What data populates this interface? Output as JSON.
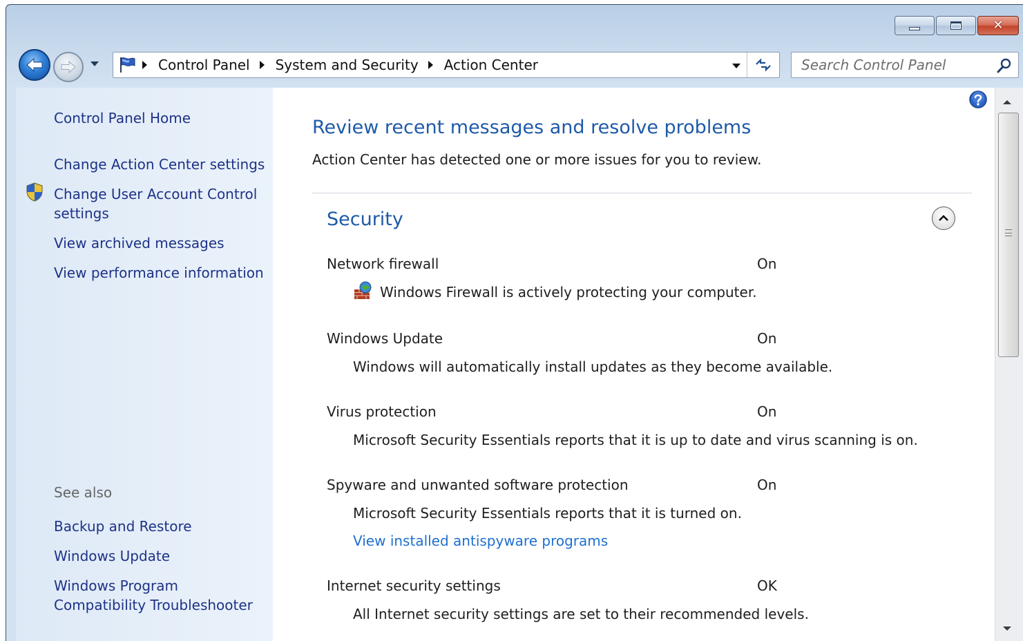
{
  "window": {
    "caption": {
      "minimize_glyph": "",
      "close_glyph": "✕"
    }
  },
  "address": {
    "crumbs": [
      "Control Panel",
      "System and Security",
      "Action Center"
    ]
  },
  "search": {
    "placeholder": "Search Control Panel"
  },
  "sidebar": {
    "items": [
      "Control Panel Home",
      "Change Action Center settings",
      "Change User Account Control settings",
      "View archived messages",
      "View performance information"
    ],
    "see_also_label": "See also",
    "see_also": [
      "Backup and Restore",
      "Windows Update",
      "Windows Program Compatibility Troubleshooter"
    ]
  },
  "main": {
    "title": "Review recent messages and resolve problems",
    "subtitle": "Action Center has detected one or more issues for you to review.",
    "section_title": "Security",
    "items": [
      {
        "label": "Network firewall",
        "status": "On",
        "description": "Windows Firewall is actively protecting your computer."
      },
      {
        "label": "Windows Update",
        "status": "On",
        "description": "Windows will automatically install updates as they become available."
      },
      {
        "label": "Virus protection",
        "status": "On",
        "description": "Microsoft Security Essentials reports that it is up to date and virus scanning is on."
      },
      {
        "label": "Spyware and unwanted software protection",
        "status": "On",
        "description": "Microsoft Security Essentials reports that it is turned on.",
        "link": "View installed antispyware programs"
      },
      {
        "label": "Internet security settings",
        "status": "OK",
        "description": "All Internet security settings are set to their recommended levels."
      }
    ]
  },
  "icons": {
    "back": "back-arrow-icon",
    "forward": "forward-arrow-icon",
    "flag": "action-center-flag-icon",
    "refresh": "refresh-icon",
    "search": "search-icon",
    "help": "help-icon",
    "shield": "uac-shield-icon",
    "firewall": "firewall-icon",
    "collapse": "chevron-up-icon"
  },
  "colors": {
    "link": "#1e3287",
    "heading": "#1e5aa8",
    "accent_link": "#1e6fcf",
    "sidebar_bg": "#e6eff9"
  }
}
